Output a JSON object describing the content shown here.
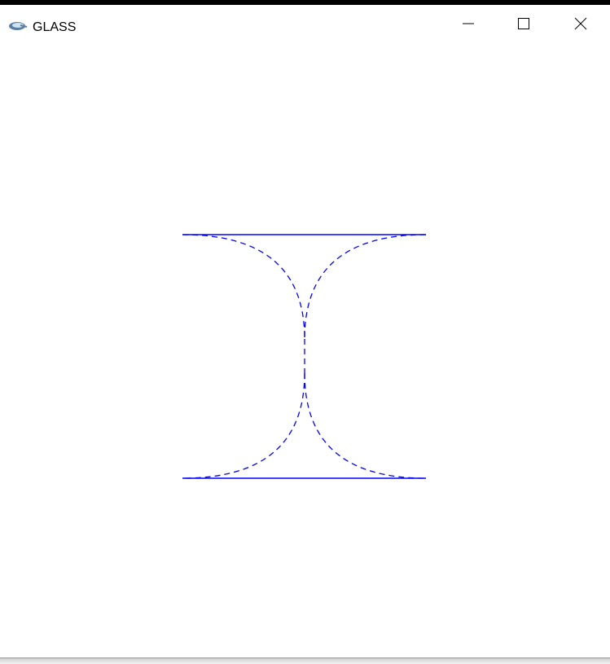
{
  "window": {
    "title": "GLASS",
    "app_icon": "app-icon",
    "controls": {
      "minimize_icon": "minimize-icon",
      "maximize_icon": "maximize-icon",
      "close_icon": "close-icon"
    }
  },
  "drawing": {
    "line_color": "#0000ff"
  }
}
